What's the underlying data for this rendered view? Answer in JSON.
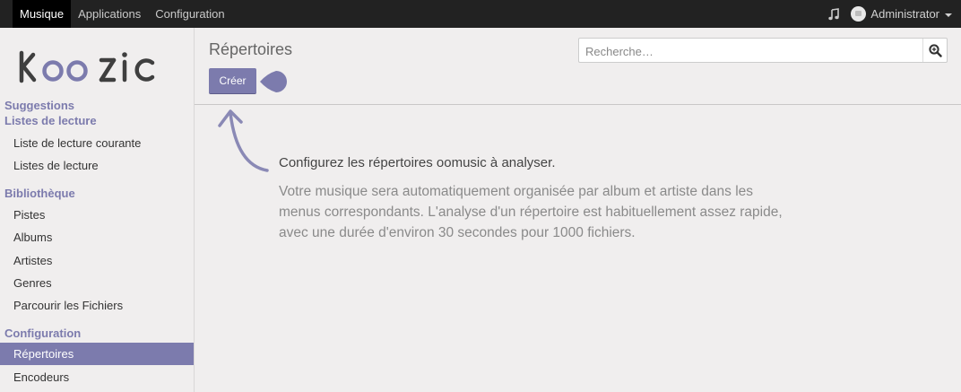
{
  "topbar": {
    "menu": [
      "Musique",
      "Applications",
      "Configuration"
    ],
    "active_index": 0,
    "user_name": "Administrator",
    "music_icon": "music-note-icon"
  },
  "sidebar": {
    "logo_text": "KooZic",
    "sections": [
      {
        "label": "Suggestions",
        "items": []
      },
      {
        "label": "Listes de lecture",
        "items": [
          "Liste de lecture courante",
          "Listes de lecture"
        ]
      },
      {
        "label": "Bibliothèque",
        "items": [
          "Pistes",
          "Albums",
          "Artistes",
          "Genres",
          "Parcourir les Fichiers"
        ]
      },
      {
        "label": "Configuration",
        "items": [
          "Répertoires",
          "Encodeurs"
        ]
      }
    ],
    "active_item": "Répertoires"
  },
  "main": {
    "title": "Répertoires",
    "create_label": "Créer",
    "search_placeholder": "Recherche…",
    "help_title": "Configurez les répertoires oomusic à analyser.",
    "help_text": "Votre musique sera automatiquement organisée par album et artiste dans les menus correspondants. L'analyse d'un répertoire est habituellement assez rapide, avec une durée d'environ 30 secondes pour 1000 fichiers."
  },
  "colors": {
    "accent": "#7c7bad",
    "topbar": "#222222",
    "background": "#f0eeee"
  }
}
